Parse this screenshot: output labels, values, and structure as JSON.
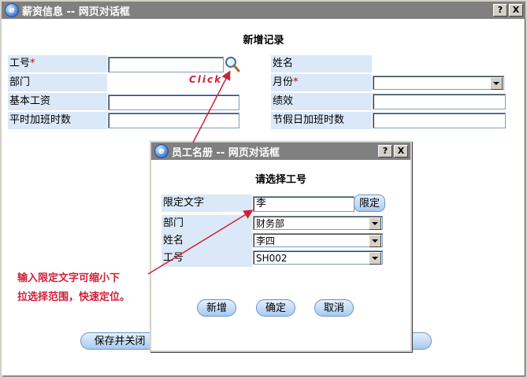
{
  "main_window": {
    "title": "薪资信息 -- 网页对话框",
    "help_btn": "?",
    "close_btn": "X",
    "heading": "新增记录",
    "fields": {
      "emp_no_label": "工号",
      "emp_no_req": "*",
      "name_label": "姓名",
      "dept_label": "部门",
      "month_label": "月份",
      "month_req": "*",
      "base_salary_label": "基本工资",
      "performance_label": "绩效",
      "weekday_ot_label": "平时加班时数",
      "holiday_ot_label": "节假日加班时数"
    },
    "save_close_btn": "保存并关闭"
  },
  "annotations": {
    "click": "Click",
    "hint_line1": "输入限定文字可缩小下",
    "hint_line2": "拉选择范围，快速定位。"
  },
  "dialog": {
    "title": "员工名册 -- 网页对话框",
    "help_btn": "?",
    "close_btn": "X",
    "heading": "请选择工号",
    "filter_label": "限定文字",
    "filter_value": "李",
    "filter_btn": "限定",
    "dept_label": "部门",
    "dept_value": "财务部",
    "name_label": "姓名",
    "name_value": "李四",
    "emp_no_label": "工号",
    "emp_no_value": "SH002",
    "add_btn": "新增",
    "ok_btn": "确定",
    "cancel_btn": "取消"
  },
  "icons": {
    "main_title_icon": "ie-icon",
    "search_icon": "magnifier-icon"
  }
}
